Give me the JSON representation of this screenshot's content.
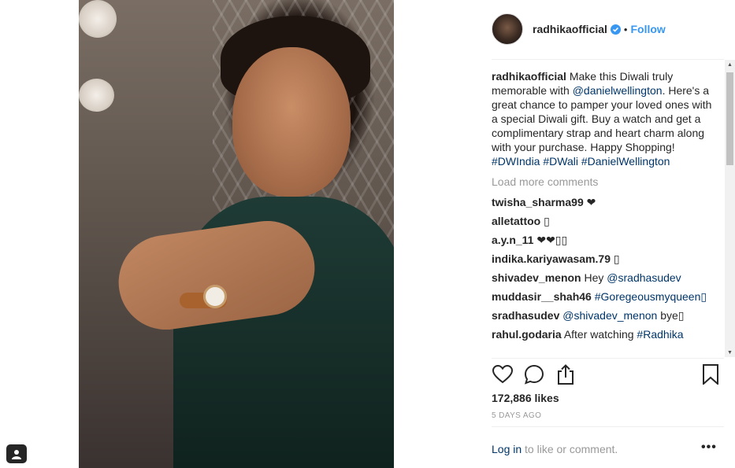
{
  "post": {
    "username": "radhikaofficial",
    "follow_label": "Follow",
    "separator": "•",
    "caption": {
      "username": "radhikaofficial",
      "text_1": "Make this Diwali truly memorable with",
      "mention": "@danielwellington",
      "text_2": ". Here's a great chance to pamper your loved ones with a special Diwali gift. Buy a watch and get a complimentary strap and heart charm along with your purchase. Happy Shopping!",
      "hashtags": [
        "#DWIndia",
        "#DWali",
        "#DanielWellington"
      ]
    },
    "load_more": "Load more comments",
    "comments": [
      {
        "user": "twisha_sharma99",
        "text": "❤",
        "link": ""
      },
      {
        "user": "alletattoo",
        "text": "▯",
        "link": ""
      },
      {
        "user": "a.y.n_11",
        "text": "❤❤▯▯",
        "link": ""
      },
      {
        "user": "indika.kariyawasam.79",
        "text": "▯",
        "link": ""
      },
      {
        "user": "shivadev_menon",
        "text": "Hey",
        "link": "@sradhasudev"
      },
      {
        "user": "muddasir__shah46",
        "text": "",
        "link": "#Goregeousmyqueen▯"
      },
      {
        "user": "sradhasudev",
        "text": "",
        "link": "@shivadev_menon",
        "after": "bye▯"
      },
      {
        "user": "rahul.godaria",
        "text": "After watching",
        "link": "#Radhika"
      }
    ],
    "likes": "172,886 likes",
    "timestamp": "5 DAYS AGO",
    "login_link": "Log in",
    "login_text": "to like or comment.",
    "more_label": "•••"
  },
  "colors": {
    "accent": "#3897f0",
    "link": "#003569",
    "muted": "#999999",
    "text": "#262626"
  },
  "icons": [
    "heart-icon",
    "comment-icon",
    "share-icon",
    "bookmark-icon",
    "verified-badge-icon",
    "tag-people-icon"
  ]
}
